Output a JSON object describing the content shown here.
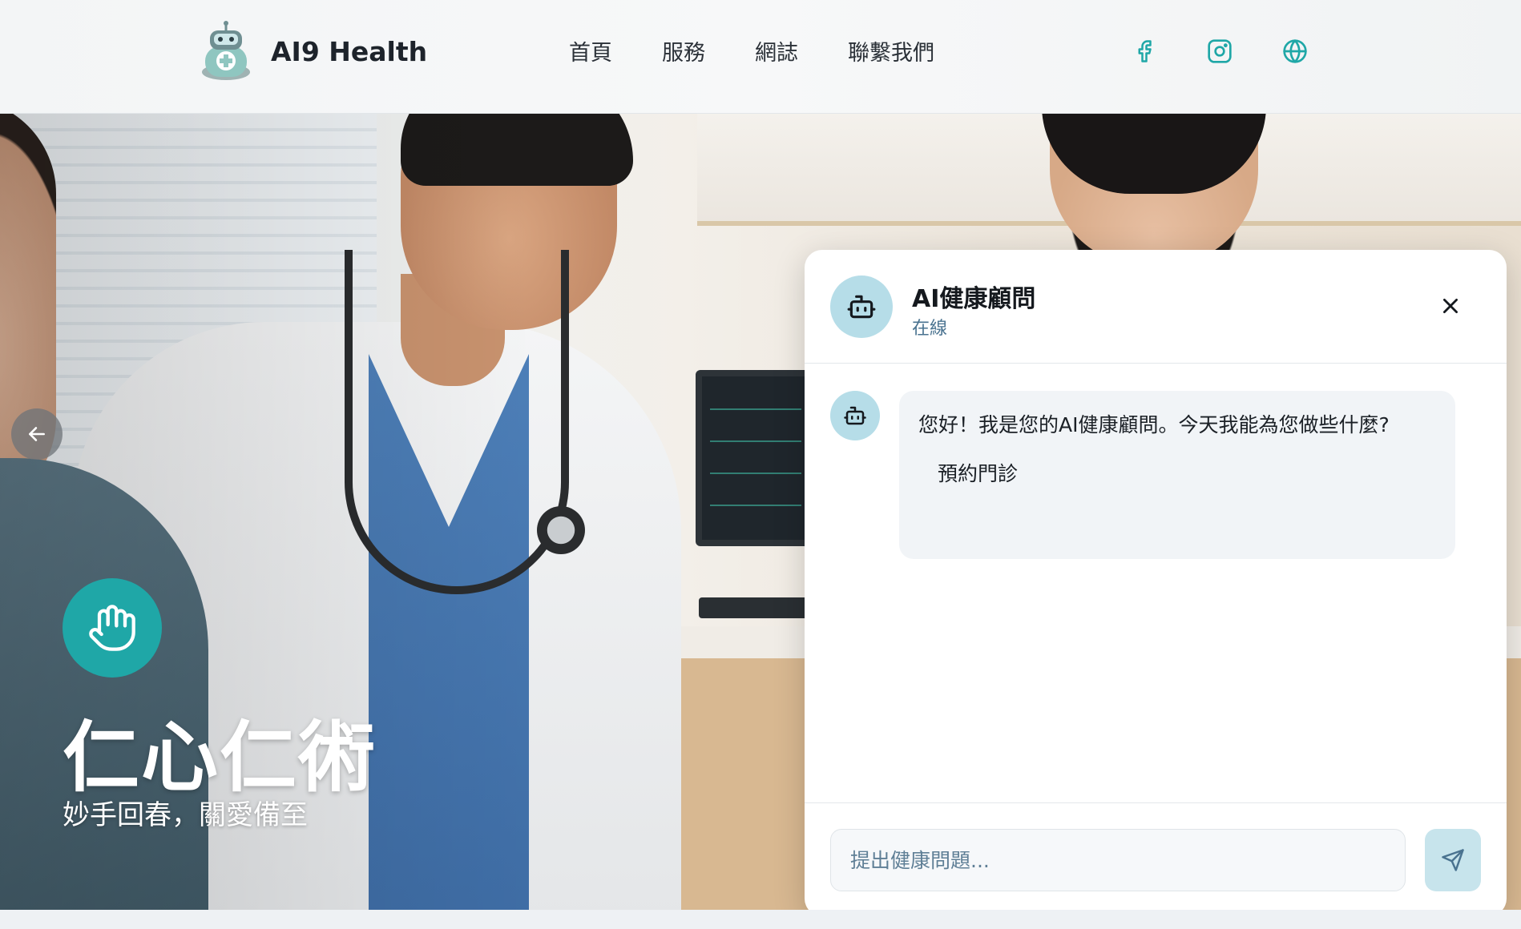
{
  "brand": {
    "name": "AI9 Health"
  },
  "nav": {
    "items": [
      {
        "label": "首頁"
      },
      {
        "label": "服務"
      },
      {
        "label": "網誌"
      },
      {
        "label": "聯繫我們"
      }
    ]
  },
  "social": {
    "icons": [
      "facebook-icon",
      "instagram-icon",
      "globe-icon"
    ]
  },
  "hero": {
    "title": "仁心仁術",
    "subtitle": "妙手回春，關愛備至",
    "badge_icon": "hand-icon"
  },
  "chat": {
    "title": "AI健康顧問",
    "status": "在線",
    "messages": [
      {
        "text": "您好！我是您的AI健康顧問。今天我能為您做些什麼?",
        "option": "預約門診"
      }
    ],
    "input_placeholder": "提出健康問題...",
    "input_value": ""
  },
  "colors": {
    "accent": "#1fa7a7",
    "avatar_bg": "#b6dde8",
    "status_text": "#4a7390"
  }
}
